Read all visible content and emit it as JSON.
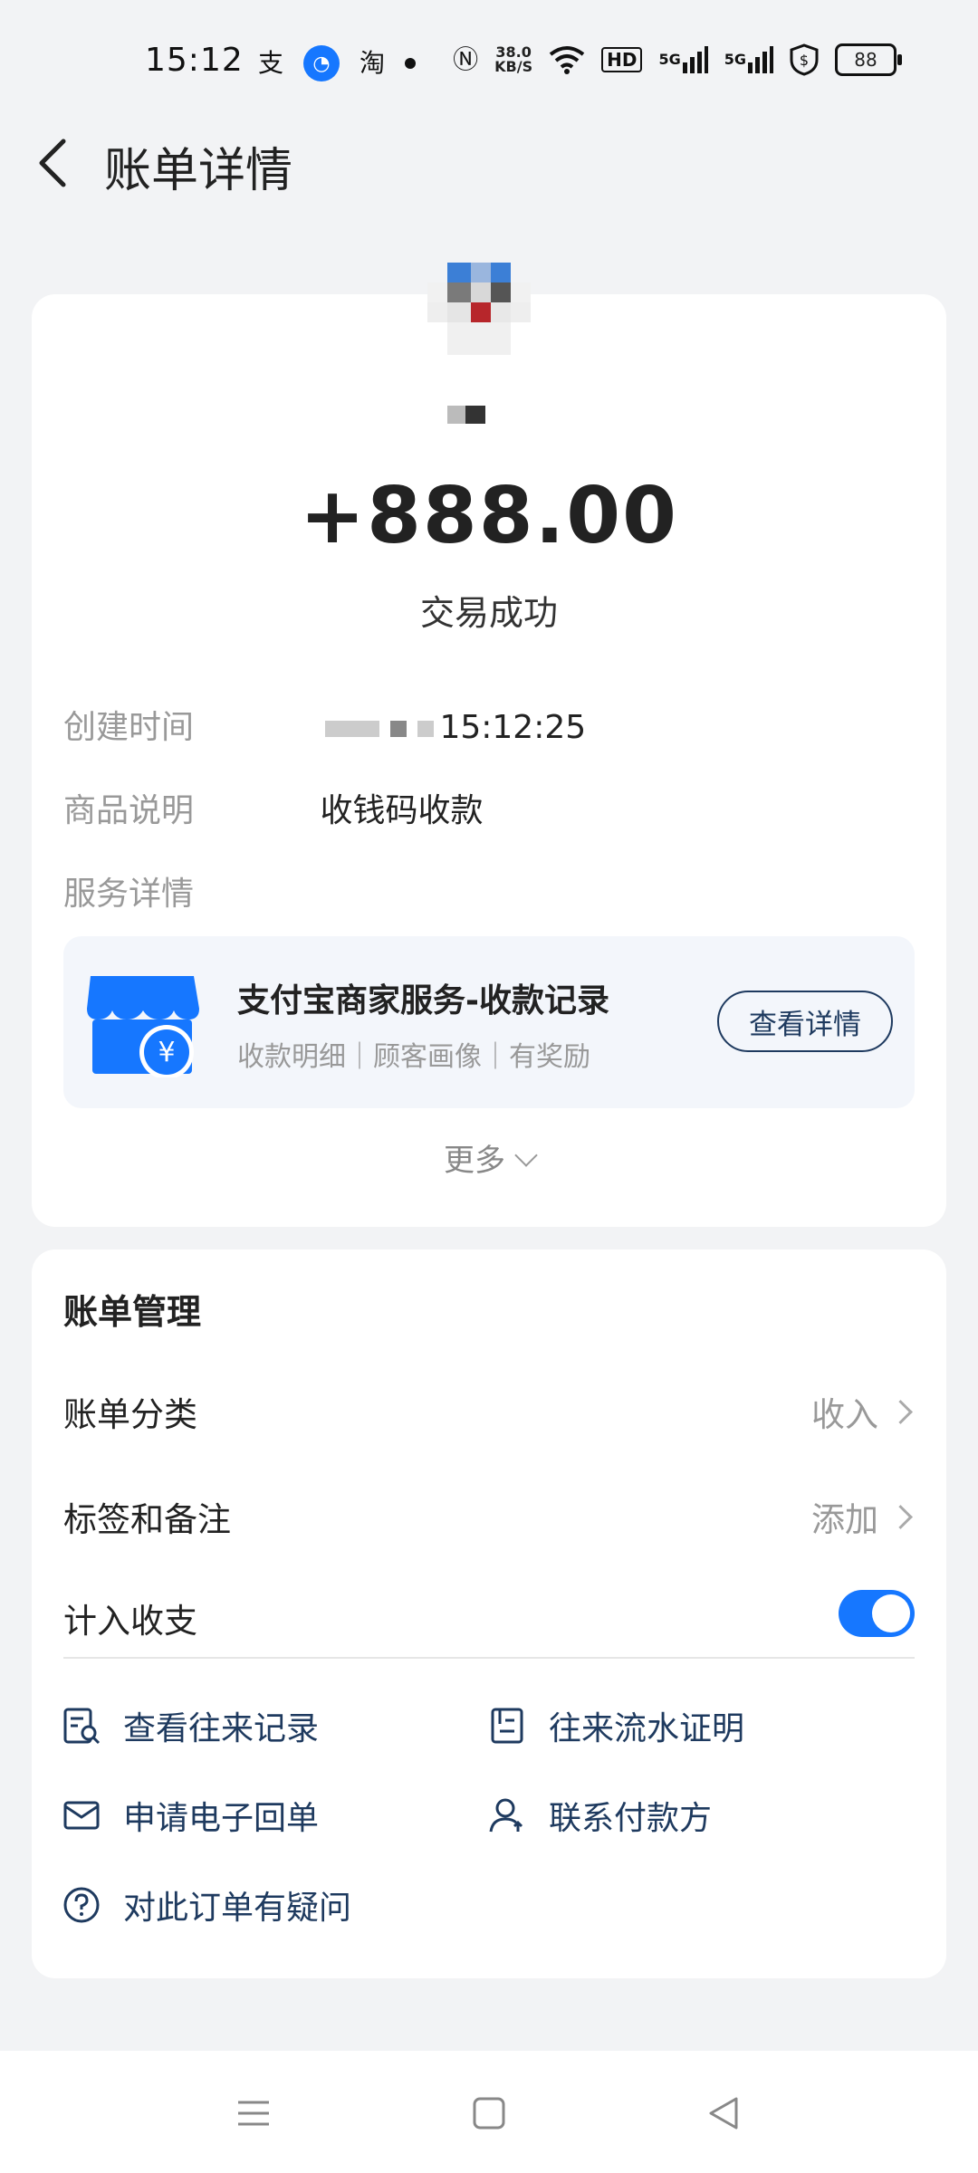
{
  "status_bar": {
    "time": "15:12",
    "app_icons": [
      "支",
      "淘"
    ],
    "speed_value": "38.0",
    "speed_unit": "KB/S",
    "hd_label": "HD",
    "net1": "5G",
    "net2": "5G",
    "battery": "88"
  },
  "header": {
    "title": "账单详情"
  },
  "bill": {
    "amount": "+888.00",
    "status": "交易成功",
    "created_label": "创建时间",
    "created_value_visible": "15:12:25",
    "goods_label": "商品说明",
    "goods_value": "收钱码收款",
    "service_label": "服务详情"
  },
  "service_card": {
    "title": "支付宝商家服务-收款记录",
    "subtitle": "收款明细｜顾客画像｜有奖励",
    "button": "查看详情"
  },
  "more": {
    "label": "更多"
  },
  "manage": {
    "title": "账单管理",
    "category_label": "账单分类",
    "category_value": "收入",
    "tags_label": "标签和备注",
    "tags_value": "添加",
    "count_label": "计入收支",
    "count_enabled": true,
    "actions": {
      "history": "查看往来记录",
      "proof": "往来流水证明",
      "receipt": "申请电子回单",
      "contact": "联系付款方",
      "question": "对此订单有疑问"
    }
  },
  "colors": {
    "accent": "#1677ff",
    "link": "#1e3a5f",
    "muted": "#999999"
  }
}
